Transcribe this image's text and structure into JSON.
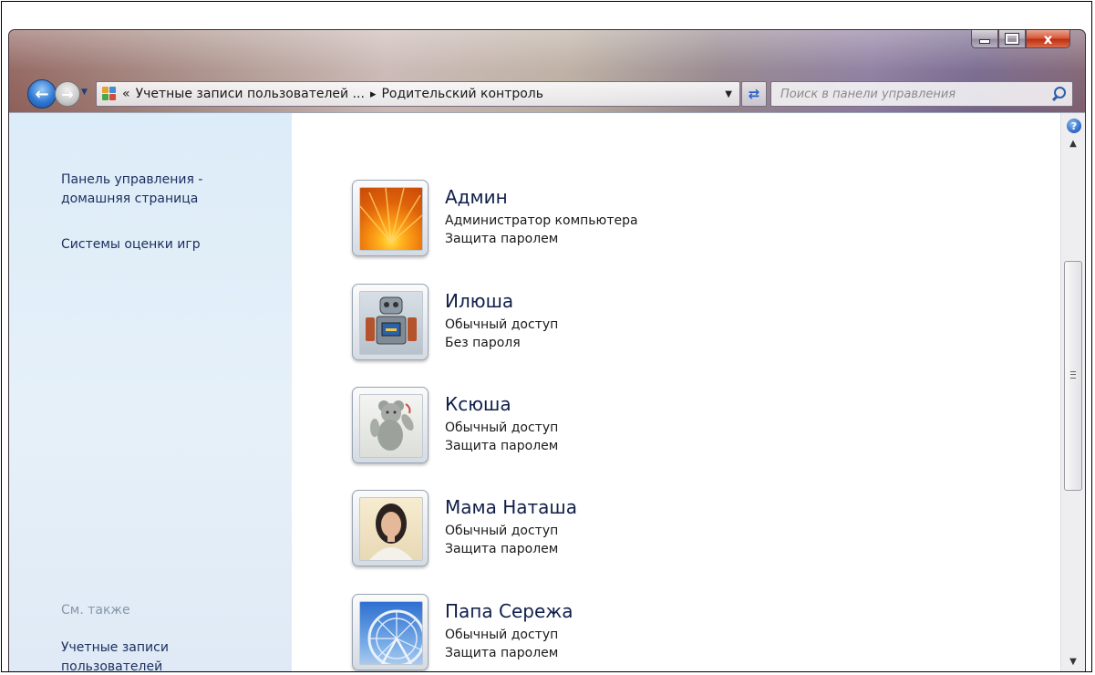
{
  "window": {
    "close_label": "x",
    "colors": {
      "accent": "#2f79d4",
      "sidebar_bg": "#dcecf8",
      "link": "#1b2e5e"
    }
  },
  "navigation": {
    "back_icon": "back-arrow-icon",
    "forward_icon": "forward-arrow-icon",
    "address": {
      "prefix": "«",
      "crumbs": [
        "Учетные записи пользователей ...",
        "Родительский контроль"
      ],
      "separator": "▸"
    },
    "refresh_icon": "refresh-icon",
    "search": {
      "placeholder": "Поиск в панели управления"
    }
  },
  "sidebar": {
    "home_link": "Панель управления - домашняя страница",
    "game_ratings_link": "Системы оценки игр",
    "see_also_title": "См. также",
    "user_accounts_link": "Учетные записи пользователей"
  },
  "users": [
    {
      "name": "Админ",
      "role": "Администратор компьютера",
      "password": "Защита паролем",
      "avatar": "flower"
    },
    {
      "name": "Илюша",
      "role": "Обычный доступ",
      "password": "Без пароля",
      "avatar": "robot"
    },
    {
      "name": "Ксюша",
      "role": "Обычный доступ",
      "password": "Защита паролем",
      "avatar": "teddy-bear"
    },
    {
      "name": "Мама Наташа",
      "role": "Обычный доступ",
      "password": "Защита паролем",
      "avatar": "photo"
    },
    {
      "name": "Папа Сережа",
      "role": "Обычный доступ",
      "password": "Защита паролем",
      "avatar": "ferris-wheel"
    }
  ],
  "scrollbar": {
    "help_label": "?"
  }
}
